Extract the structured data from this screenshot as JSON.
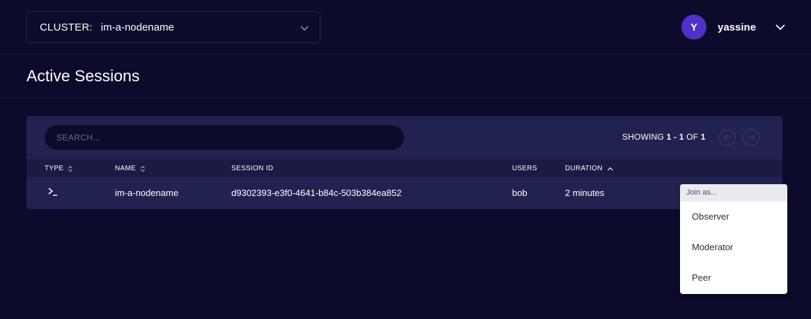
{
  "header": {
    "cluster_label": "CLUSTER:",
    "cluster_value": "im-a-nodename",
    "user_initial": "Y",
    "username": "yassine",
    "avatar_color": "#512fc9"
  },
  "page": {
    "title": "Active Sessions"
  },
  "toolbar": {
    "search_placeholder": "SEARCH...",
    "showing_prefix": "SHOWING ",
    "showing_range": "1 - 1",
    "showing_of": " OF ",
    "showing_total": "1"
  },
  "table": {
    "columns": {
      "type": "TYPE",
      "name": "NAME",
      "session_id": "SESSION ID",
      "users": "USERS",
      "duration": "DURATION"
    },
    "rows": [
      {
        "type_icon": "terminal-icon",
        "type_glyph": ">_",
        "name": "im-a-nodename",
        "session_id": "d9302393-e3f0-4641-b84c-503b384ea852",
        "users": "bob",
        "duration": "2 minutes"
      }
    ]
  },
  "join_menu": {
    "header": "Join as...",
    "items": [
      "Observer",
      "Moderator",
      "Peer"
    ]
  },
  "colors": {
    "background": "#0c0b2b",
    "panel": "#222250",
    "accent": "#512fc9"
  }
}
